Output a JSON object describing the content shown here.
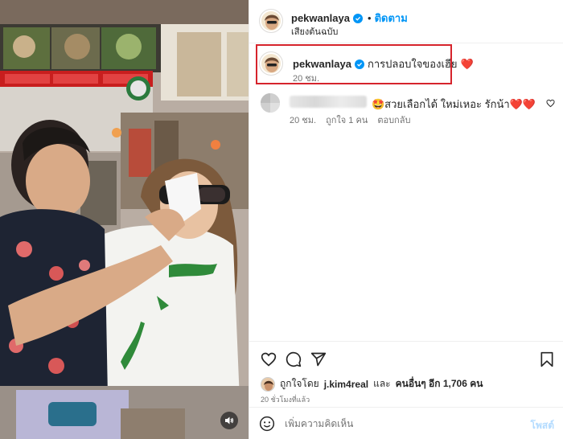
{
  "post": {
    "username": "pekwanlaya",
    "follow_label": "ติดตาม",
    "audio_label": "เสียงต้นฉบับ",
    "caption_text": "การปลอบใจของเฮีย",
    "caption_emoji": "❤️",
    "caption_time": "20 ชม."
  },
  "comment": {
    "text": "🤩สวยเลือกได้ ใหม่เหอะ รักน้า❤️❤️",
    "time": "20 ชม.",
    "likes": "ถูกใจ 1 คน",
    "reply_label": "ตอบกลับ"
  },
  "likes": {
    "prefix": "ถูกใจโดย",
    "user": "j.kim4real",
    "conj": "และ",
    "others": "คนอื่นๆ อีก 1,706 คน"
  },
  "post_age": "20 ชั่วโมงที่แล้ว",
  "comment_box": {
    "placeholder": "เพิ่มความคิดเห็น",
    "post_label": "โพสต์"
  },
  "colors": {
    "accent_blue": "#0095f6",
    "highlight_red": "#d6242c",
    "heart_red": "#e0245e"
  },
  "icons": [
    "heart-icon",
    "comment-icon",
    "share-icon",
    "bookmark-icon",
    "emoji-icon",
    "volume-icon",
    "verified-badge-icon"
  ]
}
